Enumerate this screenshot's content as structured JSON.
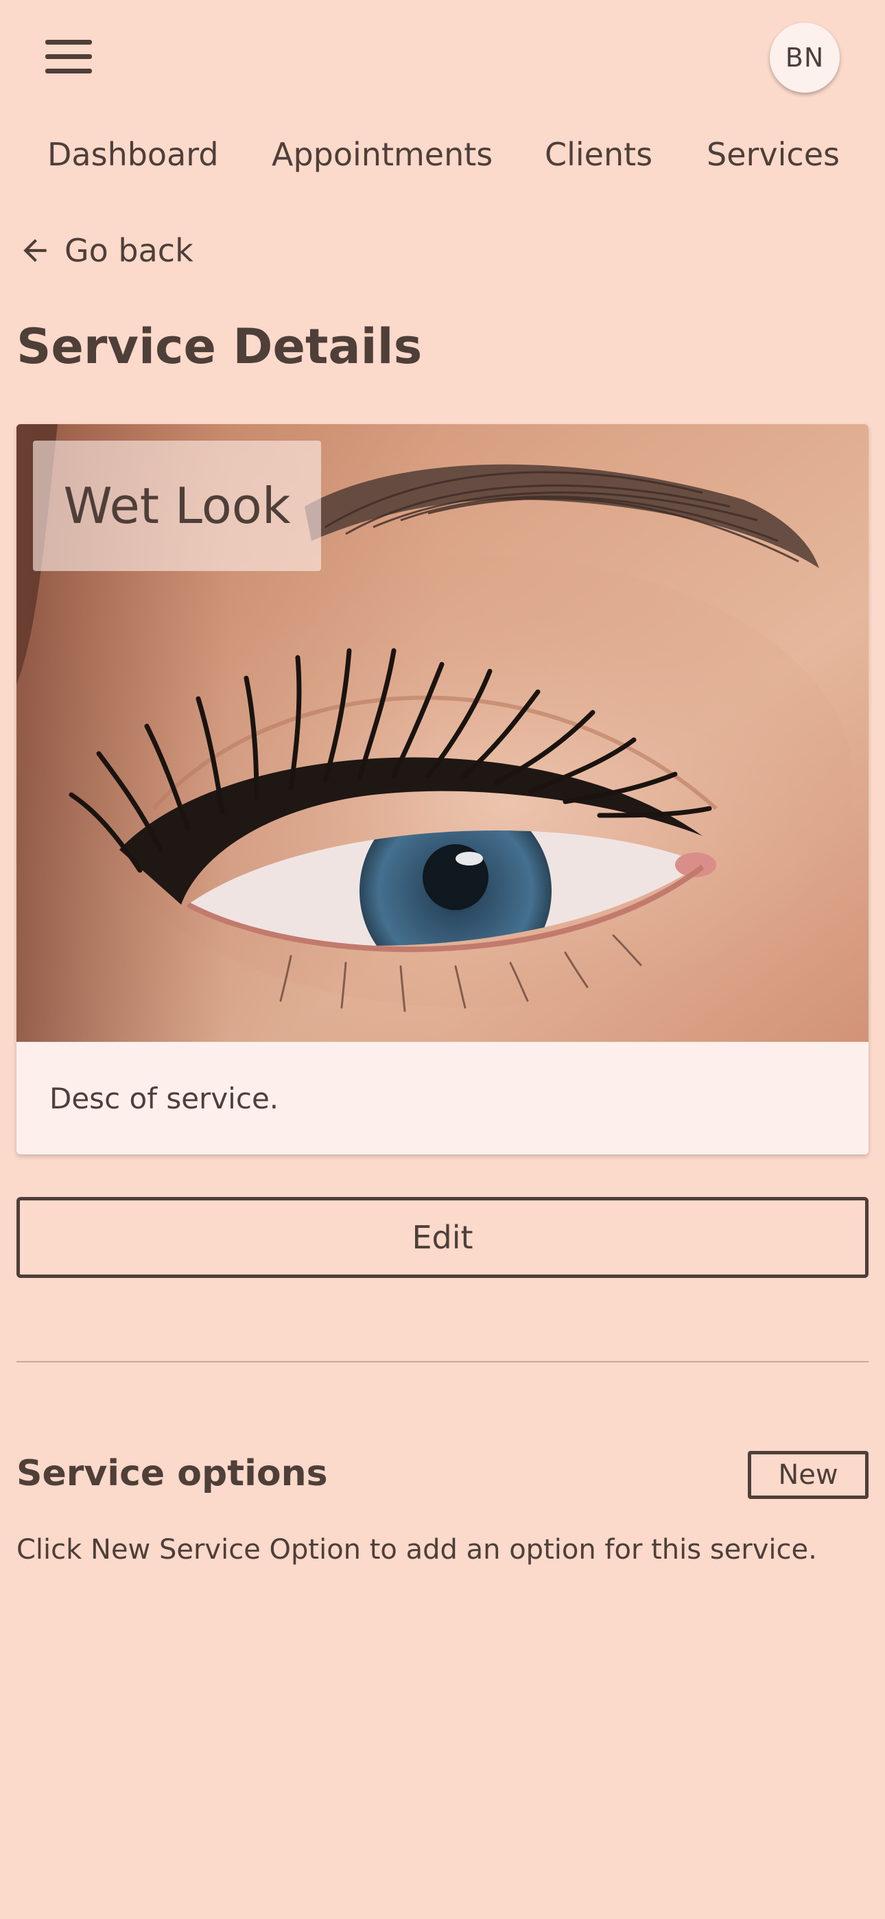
{
  "header": {
    "menu_icon": "hamburger-menu-icon",
    "avatar_initials": "BN"
  },
  "nav": {
    "items": [
      {
        "label": "Dashboard"
      },
      {
        "label": "Appointments"
      },
      {
        "label": "Clients"
      },
      {
        "label": "Services"
      }
    ]
  },
  "back": {
    "icon": "arrow-left-icon",
    "label": "Go back"
  },
  "page": {
    "title": "Service Details"
  },
  "service": {
    "name": "Wet Look",
    "description": "Desc of service.",
    "edit_label": "Edit"
  },
  "options": {
    "title": "Service options",
    "new_label": "New",
    "hint": "Click New Service Option to add an option for this service."
  },
  "colors": {
    "background": "#fbd9cb",
    "text": "#4e3f38",
    "card": "#fdf0ec"
  }
}
